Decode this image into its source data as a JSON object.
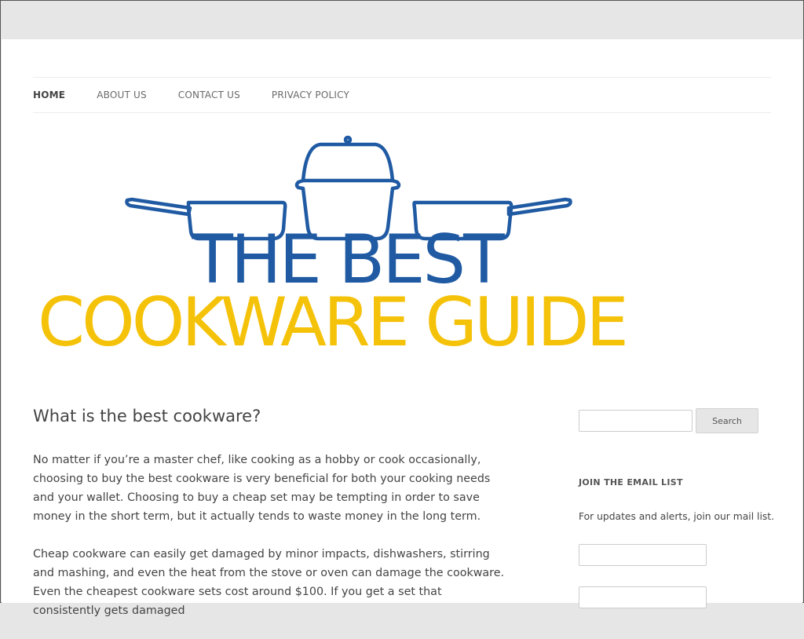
{
  "nav": {
    "items": [
      {
        "label": "HOME",
        "active": true
      },
      {
        "label": "ABOUT US",
        "active": false
      },
      {
        "label": "CONTACT US",
        "active": false
      },
      {
        "label": "PRIVACY POLICY",
        "active": false
      }
    ]
  },
  "logo": {
    "line1": "THE BEST",
    "line2": "COOKWARE GUIDE",
    "colors": {
      "blue": "#1f5aa3",
      "yellow": "#f5c20a"
    },
    "icon": "cookware-pots-icon"
  },
  "article": {
    "title": "What is the best cookware?",
    "paragraphs": [
      "No matter if you’re a master chef, like cooking as a hobby or cook occasionally, choosing to buy the best cookware is very beneficial for both your cooking needs and your wallet. Choosing to buy a cheap set may be tempting in order to save money in the short term, but it actually tends to waste money in the long term.",
      "Cheap cookware can easily get damaged by minor impacts, dishwashers, stirring and mashing, and even the heat from the stove or oven can damage the cookware. Even the cheapest cookware sets cost around $100. If you get a set that consistently gets damaged"
    ]
  },
  "sidebar": {
    "search": {
      "value": "",
      "button_label": "Search"
    },
    "email_widget": {
      "title": "JOIN THE EMAIL LIST",
      "text": "For updates and alerts, join our mail list."
    }
  }
}
